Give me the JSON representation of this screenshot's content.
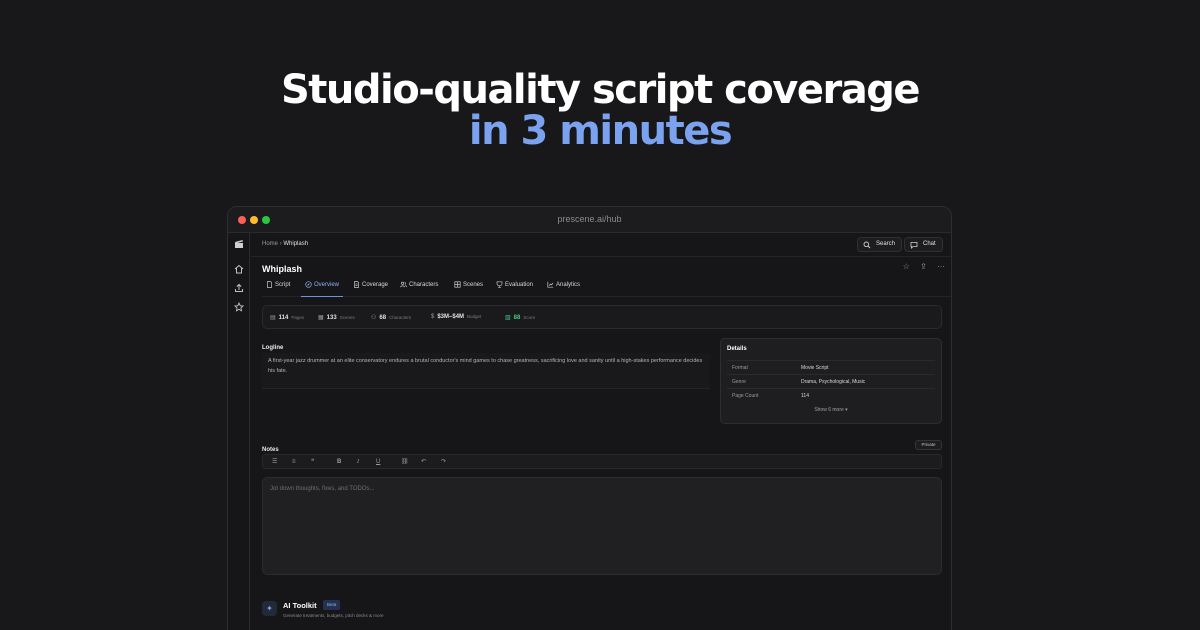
{
  "hero": {
    "line1": "Studio-quality script coverage",
    "line2": "in 3 minutes"
  },
  "window": {
    "url": "prescene.ai/hub"
  },
  "breadcrumb": {
    "home": "Home",
    "current": "Whiplash"
  },
  "topbar": {
    "search": "Search",
    "chat": "Chat"
  },
  "project": {
    "title": "Whiplash"
  },
  "tabs": [
    "Script",
    "Overview",
    "Coverage",
    "Characters",
    "Scenes",
    "Evaluation",
    "Analytics"
  ],
  "stats": {
    "pages": {
      "value": "114",
      "label": "Pages"
    },
    "scenes": {
      "value": "133",
      "label": "Scenes"
    },
    "characters": {
      "value": "68",
      "label": "Characters"
    },
    "budget": {
      "value": "$3M–$4M",
      "label": "Budget"
    },
    "score": {
      "value": "88",
      "label": "Score"
    }
  },
  "logline": {
    "heading": "Logline",
    "text": "A first-year jazz drummer at an elite conservatory endures a brutal conductor's mind games to chase greatness, sacrificing love and sanity until a high-stakes performance decides his fate."
  },
  "details": {
    "heading": "Details",
    "rows": [
      {
        "key": "Format",
        "value": "Movie Script"
      },
      {
        "key": "Genre",
        "value": "Drama, Psychological, Music"
      },
      {
        "key": "Page Count",
        "value": "114"
      }
    ],
    "show_more": "Show 6 more ▾"
  },
  "notes": {
    "heading": "Notes",
    "private": "Private",
    "placeholder": "Jot down thoughts, fixes, and TODOs..."
  },
  "ai_toolkit": {
    "title": "AI Toolkit",
    "badge": "Beta",
    "subtitle": "Generate treatments, budgets, pitch decks & more"
  },
  "colors": {
    "accent": "#7aa2ee",
    "score": "#48c98a",
    "background": "#18181a"
  }
}
